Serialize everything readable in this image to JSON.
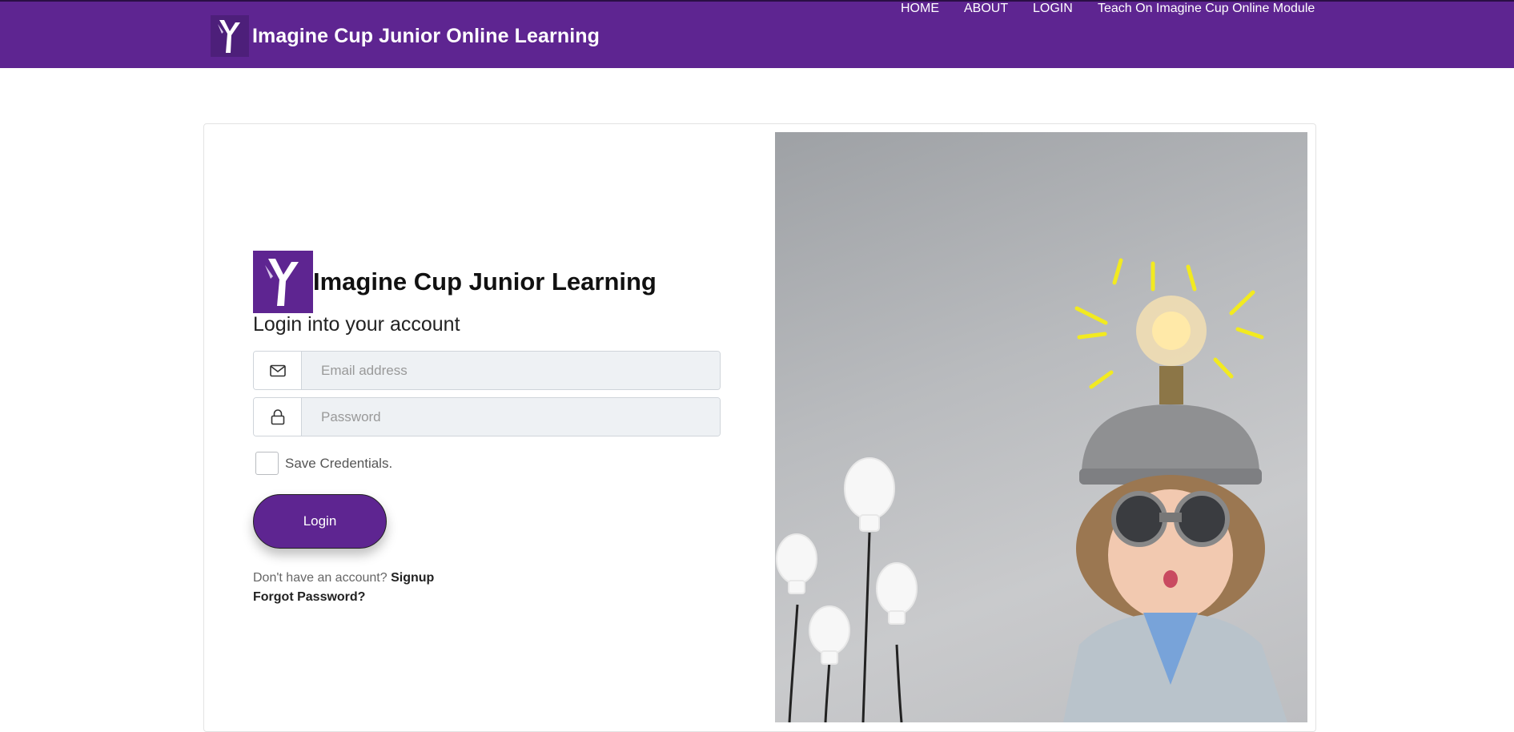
{
  "navbar": {
    "brand": "Imagine Cup Junior Online Learning",
    "links": [
      {
        "label": "HOME"
      },
      {
        "label": "ABOUT"
      },
      {
        "label": "LOGIN"
      },
      {
        "label": "Teach On Imagine Cup Online Module"
      }
    ],
    "background": "#5e2591"
  },
  "login": {
    "brand": "Imagine Cup Junior Learning",
    "title": "Login into your account",
    "email_placeholder": "Email address",
    "email_icon": "envelope-icon",
    "password_placeholder": "Password",
    "password_icon": "lock-icon",
    "save_label": "Save Credentials.",
    "save_checked": false,
    "button": "Login",
    "no_account": "Don't have an account?",
    "signup": "Signup",
    "forgot": "Forgot Password?"
  },
  "hero": {
    "image": "child-with-lightbulb-helmet"
  }
}
